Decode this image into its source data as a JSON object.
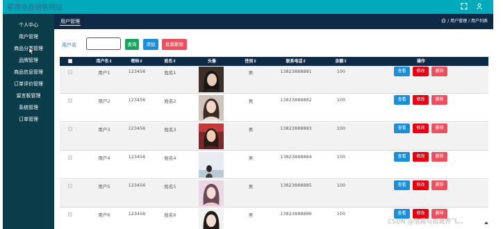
{
  "app": {
    "title": "家用电器销售网站"
  },
  "sidebar": {
    "items": [
      {
        "label": "个人中心"
      },
      {
        "label": "用户管理"
      },
      {
        "label": "商品分类管理"
      },
      {
        "label": "品牌管理"
      },
      {
        "label": "商品信息管理"
      },
      {
        "label": "订单评价管理"
      },
      {
        "label": "留言板管理"
      },
      {
        "label": "系统管理"
      },
      {
        "label": "订单管理"
      }
    ]
  },
  "header": {
    "active_tab": "用户管理",
    "breadcrumb": "/ 用户管理 / 用户列表"
  },
  "search": {
    "label": "用户名",
    "value": "",
    "placeholder": "",
    "query_label": "查询",
    "add_label": "添加",
    "batch_delete_label": "批量删除"
  },
  "table": {
    "columns": [
      "用户名",
      "密码",
      "姓名",
      "头像",
      "性别",
      "联系电话",
      "余额",
      "操作"
    ],
    "sort_marks": [
      "⇕",
      "⇕",
      "⇕",
      "",
      "⇕",
      "⇕",
      "⇕",
      ""
    ],
    "rows": [
      {
        "username": "用户1",
        "password": "123456",
        "name": "姓名1",
        "gender": "男",
        "phone": "13823888881",
        "balance": "100",
        "avatar": "avatar-1"
      },
      {
        "username": "用户2",
        "password": "123456",
        "name": "姓名2",
        "gender": "男",
        "phone": "13823888882",
        "balance": "100",
        "avatar": "avatar-2"
      },
      {
        "username": "用户3",
        "password": "123456",
        "name": "姓名3",
        "gender": "男",
        "phone": "13823888883",
        "balance": "100",
        "avatar": "avatar-3"
      },
      {
        "username": "用户4",
        "password": "123456",
        "name": "姓名4",
        "gender": "男",
        "phone": "13823888884",
        "balance": "100",
        "avatar": "avatar-4"
      },
      {
        "username": "用户5",
        "password": "123456",
        "name": "姓名5",
        "gender": "男",
        "phone": "13823888885",
        "balance": "100",
        "avatar": "avatar-5"
      },
      {
        "username": "用户6",
        "password": "123456",
        "name": "姓名6",
        "gender": "男",
        "phone": "13823888886",
        "balance": "100",
        "avatar": "avatar-6"
      }
    ],
    "actions": {
      "view": "查看",
      "edit": "修改",
      "delete": "删除"
    }
  },
  "watermark": "CSDN @落霞与孤鹜齐飞。。",
  "colors": {
    "topbar": "#00aabb",
    "sidebar": "#0b3c4a",
    "header_bar": "#0e2a47",
    "btn_query": "#1aa260",
    "btn_add": "#1a8fd8",
    "btn_batch_delete": "#ee4f5e",
    "btn_view": "#1a8fd8",
    "btn_edit": "#e60012",
    "btn_delete": "#ee4f5e"
  },
  "icons": {
    "topbar_left": "fullscreen-icon",
    "topbar_right": "user-icon",
    "breadcrumb": "home-icon",
    "scroll": "scroll-up-icon"
  }
}
